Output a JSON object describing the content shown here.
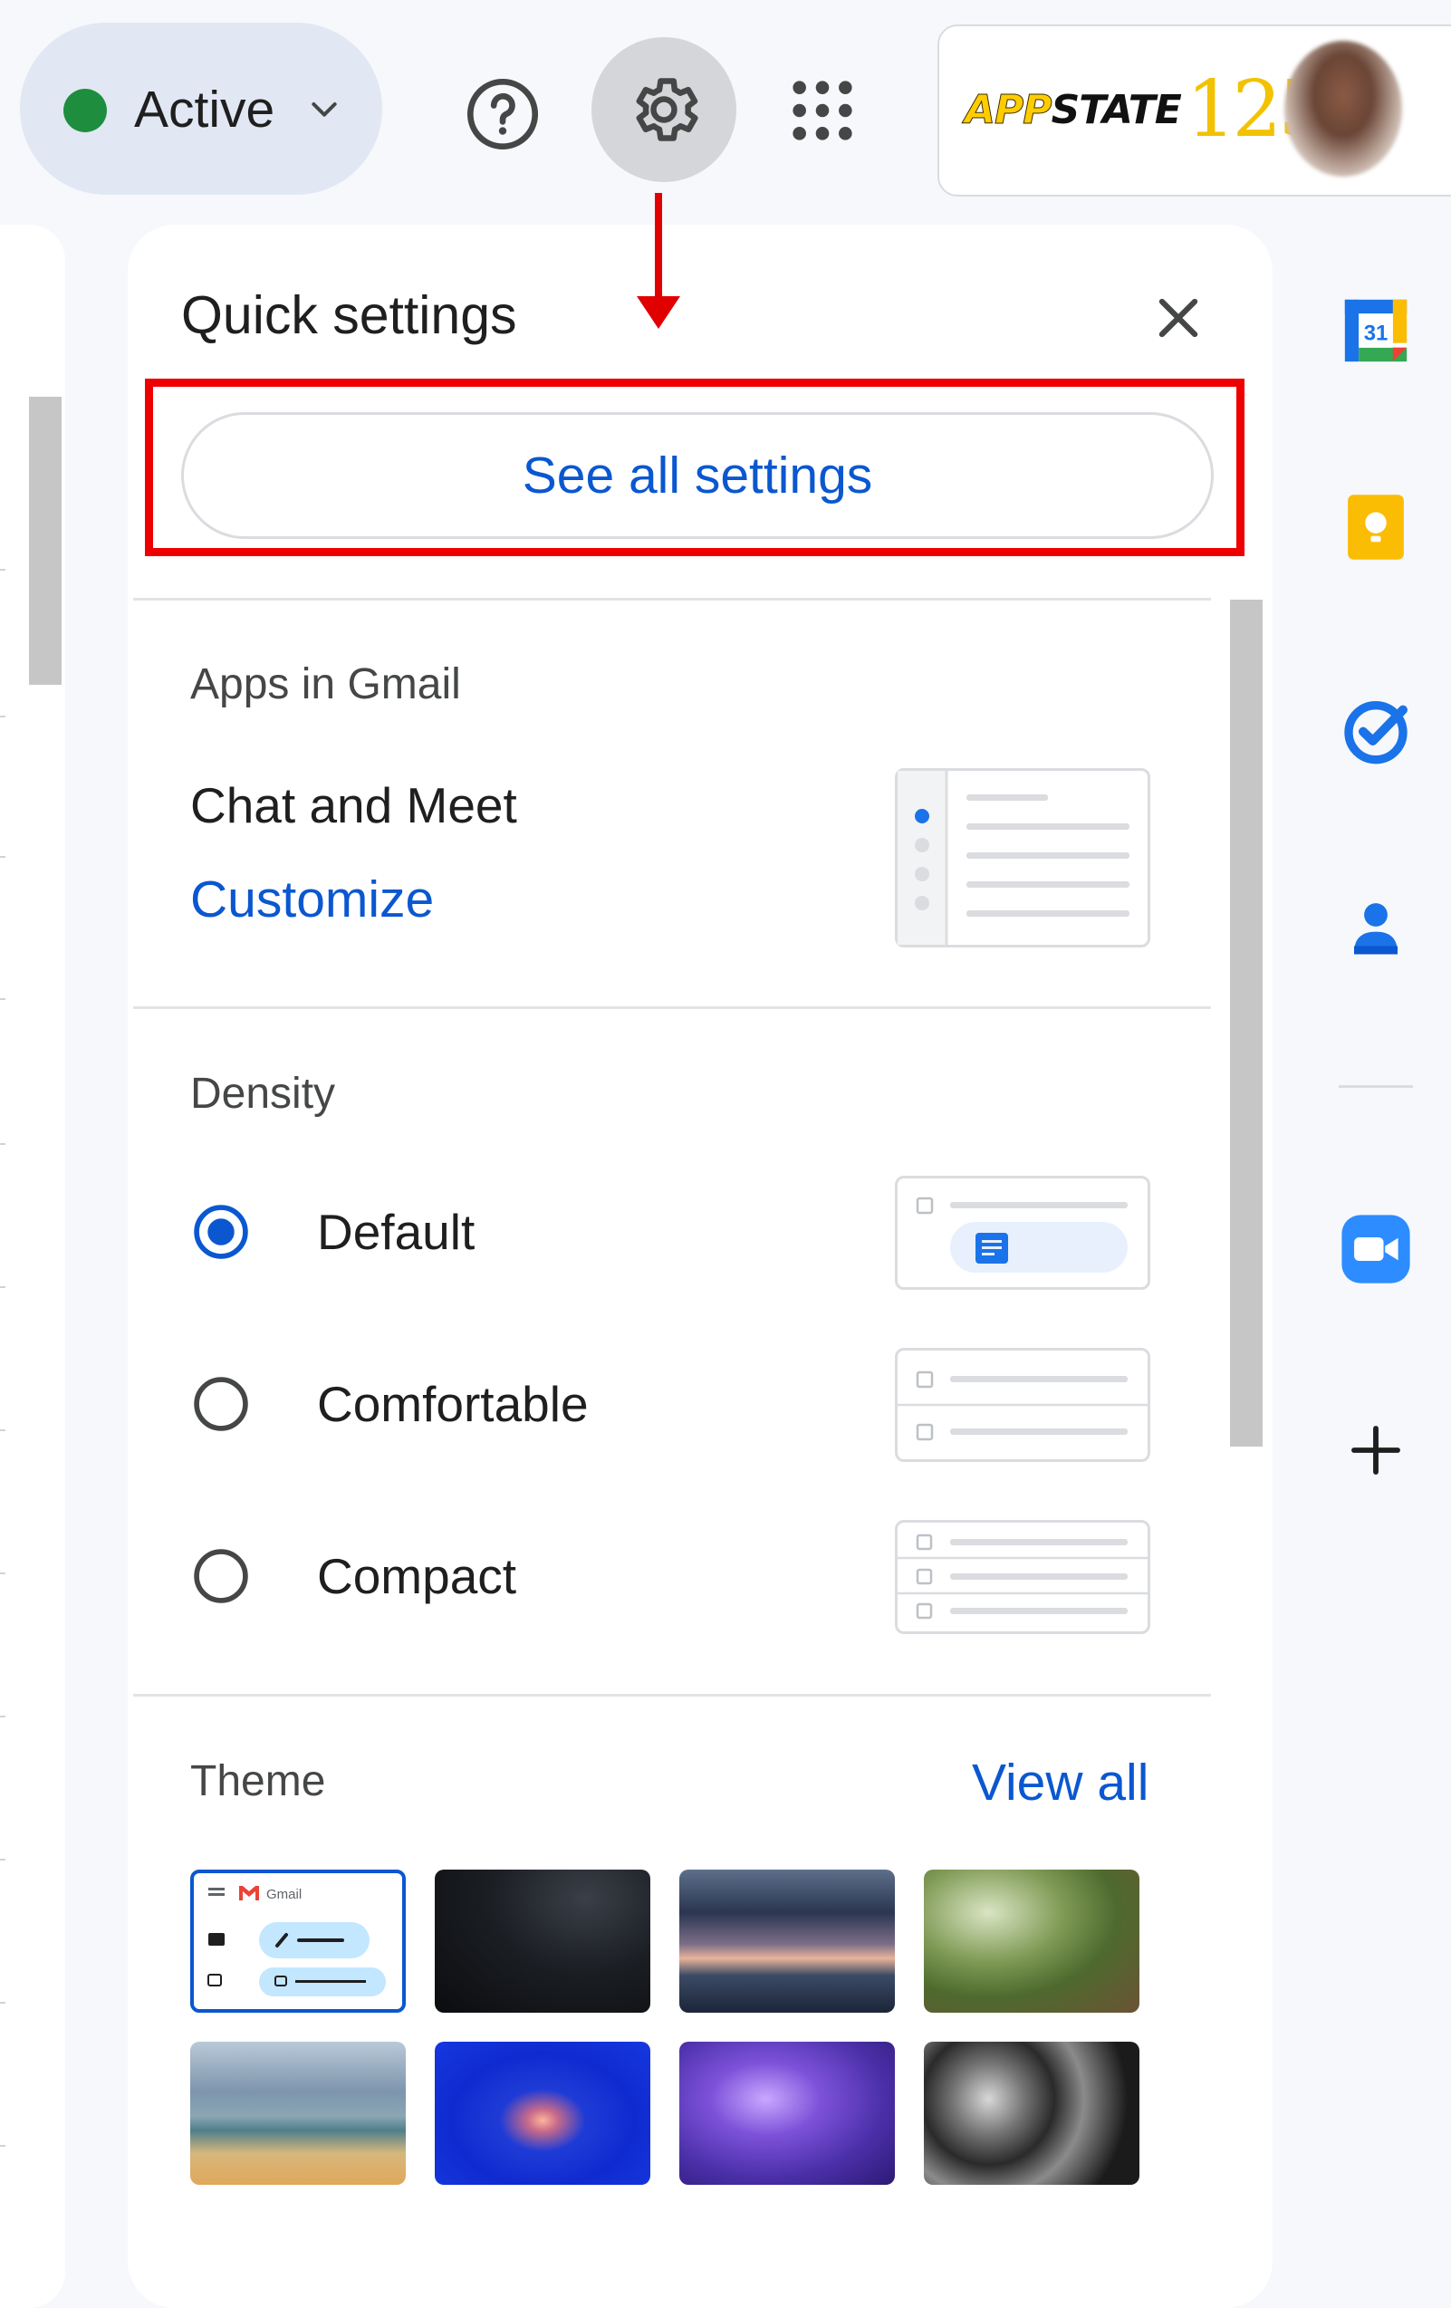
{
  "topbar": {
    "status_label": "Active",
    "status_color": "#1e8e3e",
    "icons": [
      "help-icon",
      "gear-icon",
      "apps-grid-icon"
    ],
    "brand": {
      "part1": "APP",
      "part2": "STATE",
      "number": "125"
    }
  },
  "quick_settings": {
    "title": "Quick settings",
    "see_all_label": "See all settings",
    "apps_section": {
      "title": "Apps in Gmail",
      "item_label": "Chat and Meet",
      "customize_label": "Customize"
    },
    "density": {
      "title": "Density",
      "options": [
        {
          "label": "Default",
          "selected": true
        },
        {
          "label": "Comfortable",
          "selected": false
        },
        {
          "label": "Compact",
          "selected": false
        }
      ]
    },
    "theme": {
      "title": "Theme",
      "view_all_label": "View all",
      "thumb_gmail_label": "Gmail",
      "tiles": [
        "default",
        "starry-night",
        "stormy-sky",
        "forest-stream",
        "beach",
        "jellyfish",
        "purple-jellyfish",
        "metal-tubes"
      ]
    }
  },
  "side_rail": {
    "calendar_day": "31",
    "items": [
      "calendar-icon",
      "keep-icon",
      "tasks-icon",
      "contacts-icon",
      "zoom-icon",
      "add-icon"
    ]
  },
  "annotation_color": "#ee0000",
  "accent_color": "#0b57d0"
}
